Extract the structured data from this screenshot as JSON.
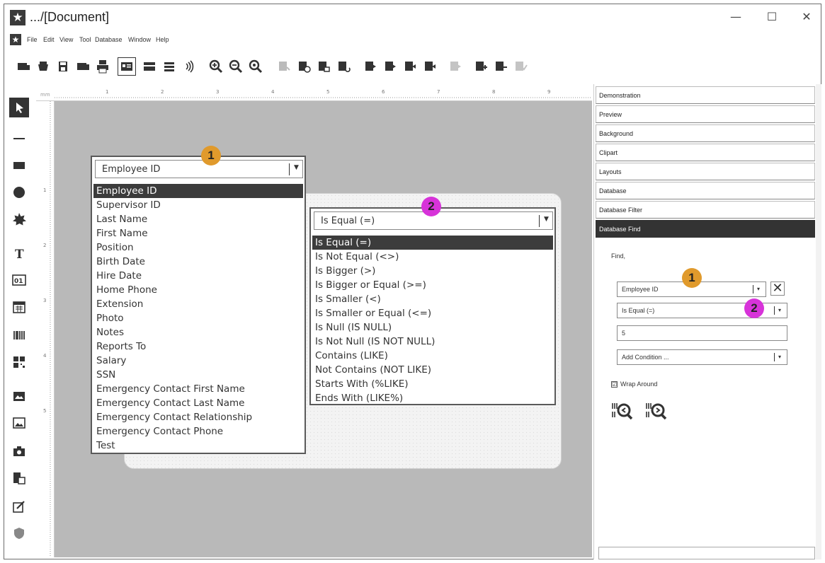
{
  "window": {
    "title": ".../[Document]",
    "controls": {
      "minimize": "—",
      "maximize": "☐",
      "close": "✕"
    }
  },
  "menu": [
    "File",
    "Edit",
    "View",
    "Tool",
    "Database",
    "Window",
    "Help"
  ],
  "toolbar_icons": [
    "new-label-icon",
    "open-icon",
    "save-icon",
    "save-as-icon",
    "print-icon",
    "label-view-icon",
    "card-view-icon",
    "list-view-icon",
    "sound-icon",
    "zoom-in-icon",
    "zoom-out-icon",
    "zoom-fit-icon",
    "db-first-icon",
    "db-prev-icon",
    "db-next-icon",
    "db-refresh-icon",
    "record-first-icon",
    "record-prev-icon",
    "record-next-icon",
    "record-last-icon",
    "record-disabled-icon",
    "record-add-icon",
    "record-remove-icon",
    "record-check-icon"
  ],
  "tools": [
    "select-arrow-icon",
    "line-icon",
    "rectangle-icon",
    "ellipse-icon",
    "star-shape-icon",
    "text-icon",
    "counter-icon",
    "calendar-icon",
    "barcode-icon",
    "qrcode-icon",
    "database-image-icon",
    "image-icon",
    "camera-icon",
    "clipart-icon",
    "signature-icon",
    "shield-icon"
  ],
  "ruler": {
    "unit": "mm",
    "marks": [
      "1",
      "2",
      "3",
      "4",
      "5",
      "6",
      "7",
      "8",
      "9"
    ],
    "vmarks": [
      "1",
      "2",
      "3",
      "4",
      "5"
    ]
  },
  "field_dropdown": {
    "badge": "1",
    "selected": "Employee ID",
    "items": [
      "Employee ID",
      "Supervisor ID",
      "Last Name",
      "First Name",
      "Position",
      "Birth Date",
      "Hire Date",
      "Home Phone",
      "Extension",
      "Photo",
      "Notes",
      "Reports To",
      "Salary",
      "SSN",
      "Emergency Contact First Name",
      "Emergency Contact Last Name",
      "Emergency Contact Relationship",
      "Emergency Contact Phone",
      "Test"
    ]
  },
  "operator_dropdown": {
    "badge": "2",
    "selected": "Is Equal (=)",
    "items": [
      "Is Equal (=)",
      "Is Not Equal (<>)",
      "Is Bigger (>)",
      "Is Bigger or Equal (>=)",
      "Is Smaller (<)",
      "Is Smaller or Equal (<=)",
      "Is Null (IS NULL)",
      "Is Not Null (IS NOT NULL)",
      "Contains (LIKE)",
      "Not Contains (NOT LIKE)",
      "Starts With (%LIKE)",
      "Ends With (LIKE%)"
    ]
  },
  "panel": {
    "sections": [
      "Demonstration",
      "Preview",
      "Background",
      "Clipart",
      "Layouts",
      "Database",
      "Database Filter",
      "Database Find"
    ],
    "active_section": "Database Find",
    "find_label": "Find,",
    "field_value": "Employee ID",
    "operator_value": "Is Equal (=)",
    "search_value": "5",
    "add_condition": "Add Condition ...",
    "wrap_around": "Wrap Around",
    "wrap_checked": "☑",
    "remove_symbol": "✕",
    "badge1": "1",
    "badge2": "2"
  },
  "colors": {
    "badge_one": "#e09a2c",
    "badge_two": "#d733d9",
    "selected_row": "#3c3c3c",
    "canvas": "#b9b9b9"
  }
}
